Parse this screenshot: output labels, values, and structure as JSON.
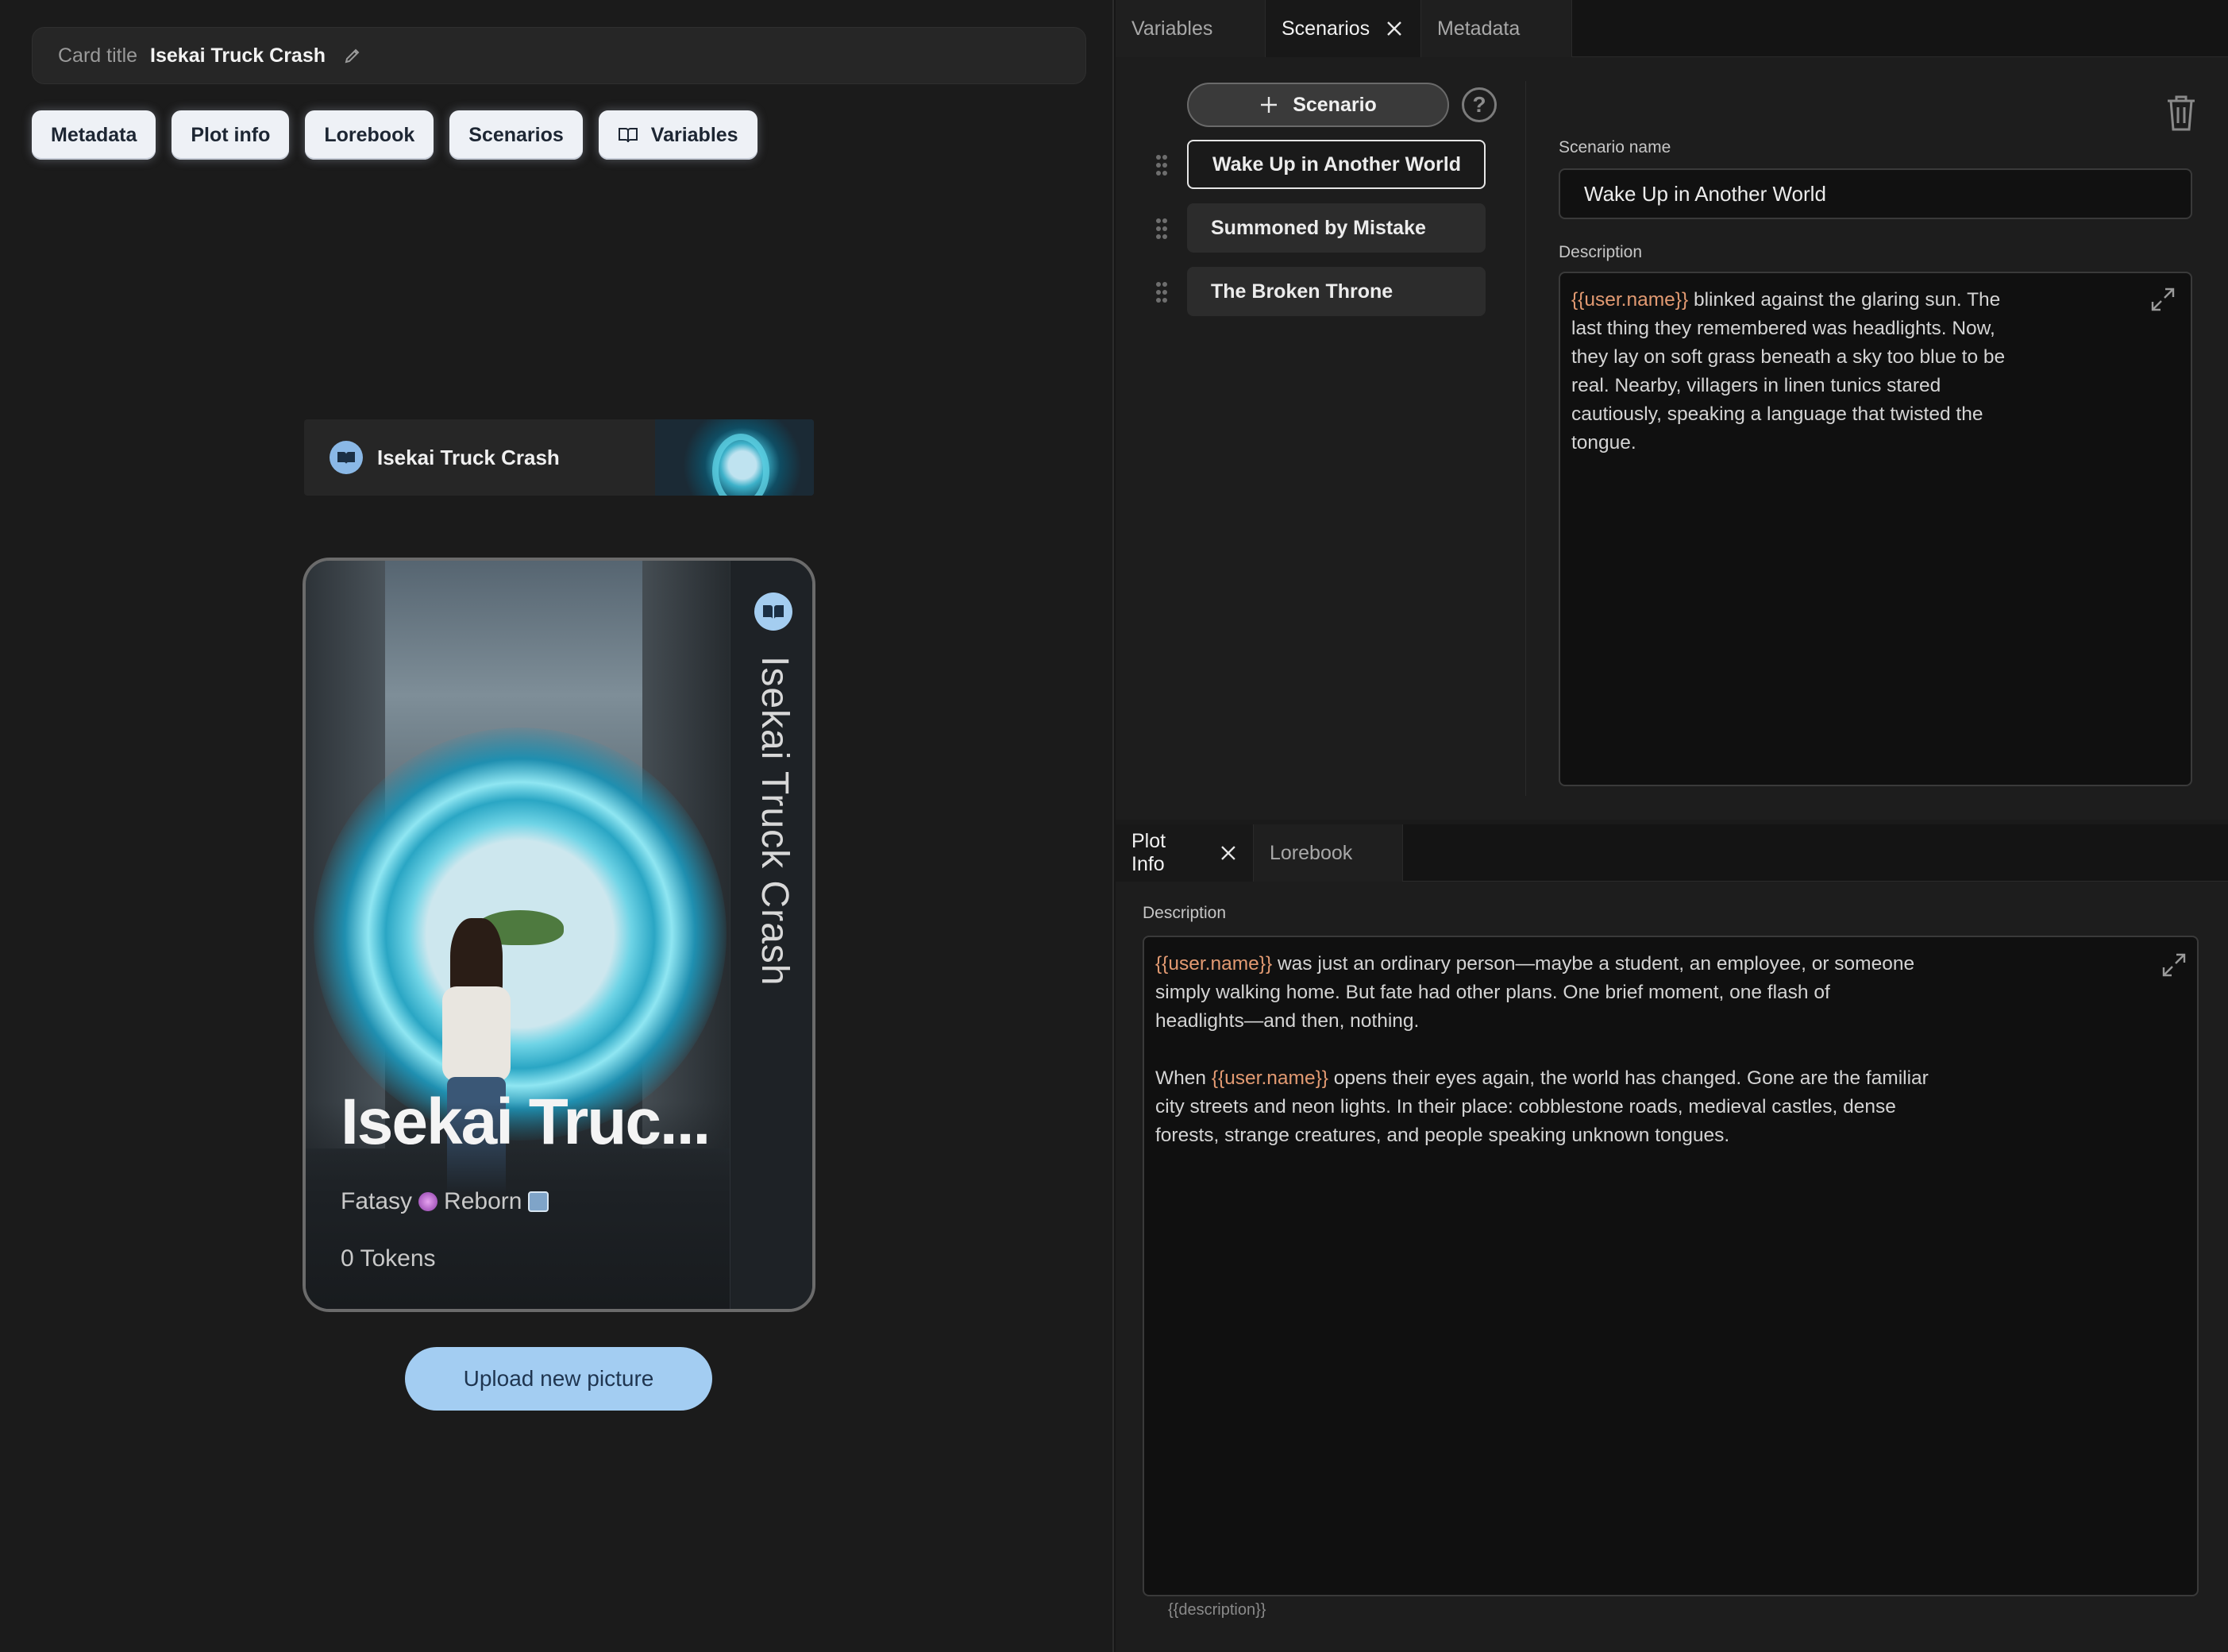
{
  "card_title": {
    "label": "Card title",
    "value": "Isekai Truck Crash"
  },
  "tag_buttons": [
    {
      "label": "Metadata"
    },
    {
      "label": "Plot info"
    },
    {
      "label": "Lorebook"
    },
    {
      "label": "Scenarios"
    },
    {
      "label": "Variables",
      "icon": "book-icon"
    }
  ],
  "banner": {
    "title": "Isekai Truck Crash"
  },
  "card": {
    "vertical_title": "Isekai Truck Crash",
    "big_title": "Isekai Truc...",
    "tags": [
      "Fatasy",
      "Reborn"
    ],
    "tokens": "0 Tokens"
  },
  "upload_label": "Upload new picture",
  "top_tabs": [
    {
      "label": "Variables",
      "active": false
    },
    {
      "label": "Scenarios",
      "active": true
    },
    {
      "label": "Metadata",
      "active": false
    }
  ],
  "scenarios": {
    "add_label": "Scenario",
    "help": "?",
    "items": [
      "Wake Up in Another World",
      "Summoned by Mistake",
      "The Broken Throne"
    ],
    "selected_index": 0,
    "name_label": "Scenario name",
    "name_value": "Wake Up in Another World",
    "description_label": "Description",
    "description_macro": "{{user.name}}",
    "description_text": " blinked against the glaring sun. The\nlast thing they remembered was headlights. Now,\nthey lay on soft grass beneath a sky too blue to be\nreal. Nearby, villagers in linen tunics stared\ncautiously, speaking a language that twisted the\ntongue."
  },
  "bottom_tabs": [
    {
      "label": "Plot Info",
      "active": true
    },
    {
      "label": "Lorebook",
      "active": false
    }
  ],
  "plot_info": {
    "description_label": "Description",
    "macro": "{{user.name}}",
    "para1_rest": " was just an ordinary person—maybe a student, an employee, or someone\nsimply walking home. But fate had other plans. One brief moment, one flash of\nheadlights—and then, nothing.",
    "para2_prefix": "When ",
    "para2_rest": " opens their eyes again, the world has changed. Gone are the familiar\ncity streets and neon lights. In their place: cobblestone roads, medieval castles, dense\nforests, strange creatures, and people speaking unknown tongues.",
    "hint": "{{description}}"
  },
  "colors": {
    "accent": "#a3cdf2",
    "macro": "#e29a72"
  }
}
